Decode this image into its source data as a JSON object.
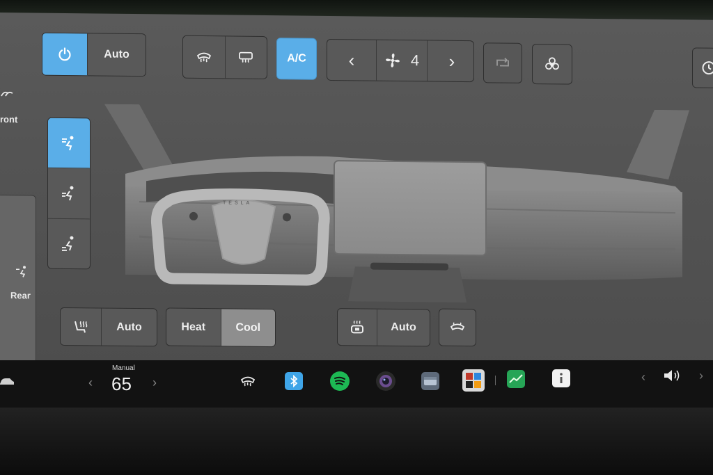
{
  "climate": {
    "power_auto_label": "Auto",
    "ac_label": "A/C",
    "fan_speed": "4",
    "fan_prev": "‹",
    "fan_next": "›",
    "front_label": "ront",
    "rear_label": "Rear"
  },
  "seat": {
    "auto_label": "Auto",
    "heat_label": "Heat",
    "cool_label": "Cool"
  },
  "steering": {
    "auto_label": "Auto"
  },
  "logo_text": "TESLA",
  "taskbar": {
    "temp_mode": "Manual",
    "temperature": "65",
    "temp_prev": "‹",
    "temp_next": "›",
    "vol_prev": "‹",
    "vol_next": "›"
  },
  "colors": {
    "accent": "#5aaee8",
    "screen_bg": "#545454",
    "taskbar_bg": "#121212",
    "spotify": "#1db954",
    "stocks": "#26a556"
  }
}
